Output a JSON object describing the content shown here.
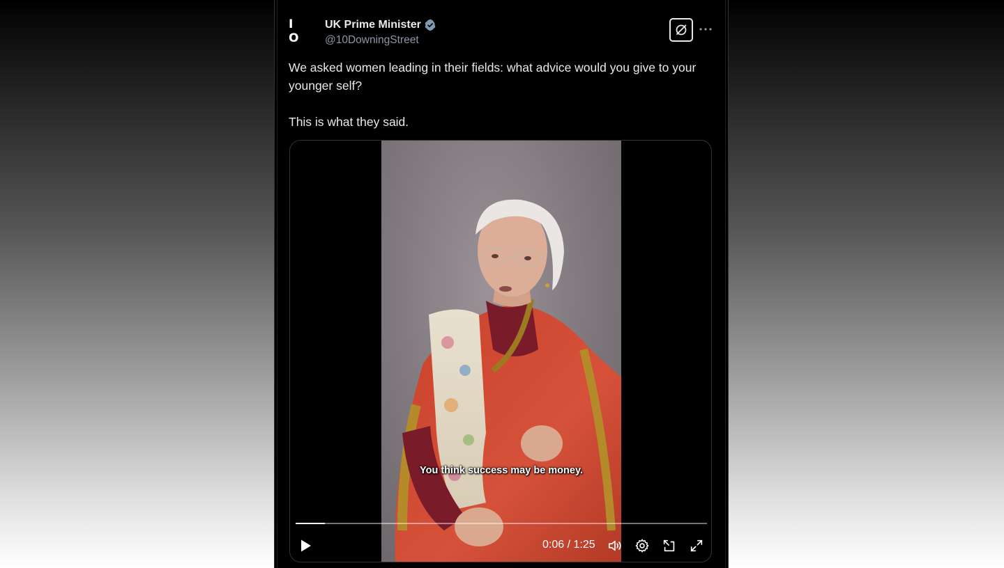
{
  "author": {
    "display_name": "UK Prime Minister",
    "handle": "@10DowningStreet",
    "avatar_text": "I O",
    "verified_color": "#829aab"
  },
  "tweet": {
    "text_line1": "We asked women leading in their fields: what advice would you give to your younger self?",
    "text_line2": "This is what they said."
  },
  "video": {
    "subtitle": "You think success may be money.",
    "current_time": "0:06",
    "duration": "1:25",
    "time_display": "0:06 / 1:25",
    "progress_fraction": 0.0706
  },
  "icons": {
    "grok": "grok-icon",
    "more": "more-icon",
    "play": "play-icon",
    "volume": "volume-icon",
    "settings": "gear-icon",
    "dock": "dock-icon",
    "fullscreen": "fullscreen-icon"
  },
  "colors": {
    "background": "#000000",
    "text": "#e7e9ea",
    "secondary": "#8b98a5"
  }
}
